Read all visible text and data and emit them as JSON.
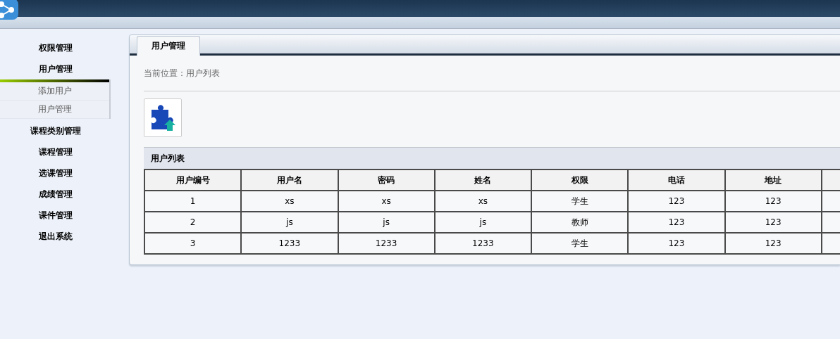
{
  "sidebar": {
    "items": [
      {
        "label": "权限管理"
      },
      {
        "label": "用户管理",
        "expanded": true,
        "children": [
          {
            "label": "添加用户"
          },
          {
            "label": "用户管理"
          }
        ]
      },
      {
        "label": "课程类别管理"
      },
      {
        "label": "课程管理"
      },
      {
        "label": "选课管理"
      },
      {
        "label": "成绩管理"
      },
      {
        "label": "课件管理"
      },
      {
        "label": "退出系统"
      }
    ]
  },
  "tabs": [
    {
      "label": "用户管理",
      "selected": true
    }
  ],
  "breadcrumb": "当前位置：用户列表",
  "table": {
    "title": "用户列表",
    "columns": [
      "用户编号",
      "用户名",
      "密码",
      "姓名",
      "权限",
      "电话",
      "地址"
    ],
    "rows": [
      [
        "1",
        "xs",
        "xs",
        "xs",
        "学生",
        "123",
        "123"
      ],
      [
        "2",
        "js",
        "js",
        "js",
        "教师",
        "123",
        "123"
      ],
      [
        "3",
        "1233",
        "1233",
        "1233",
        "学生",
        "123",
        "123"
      ]
    ]
  }
}
